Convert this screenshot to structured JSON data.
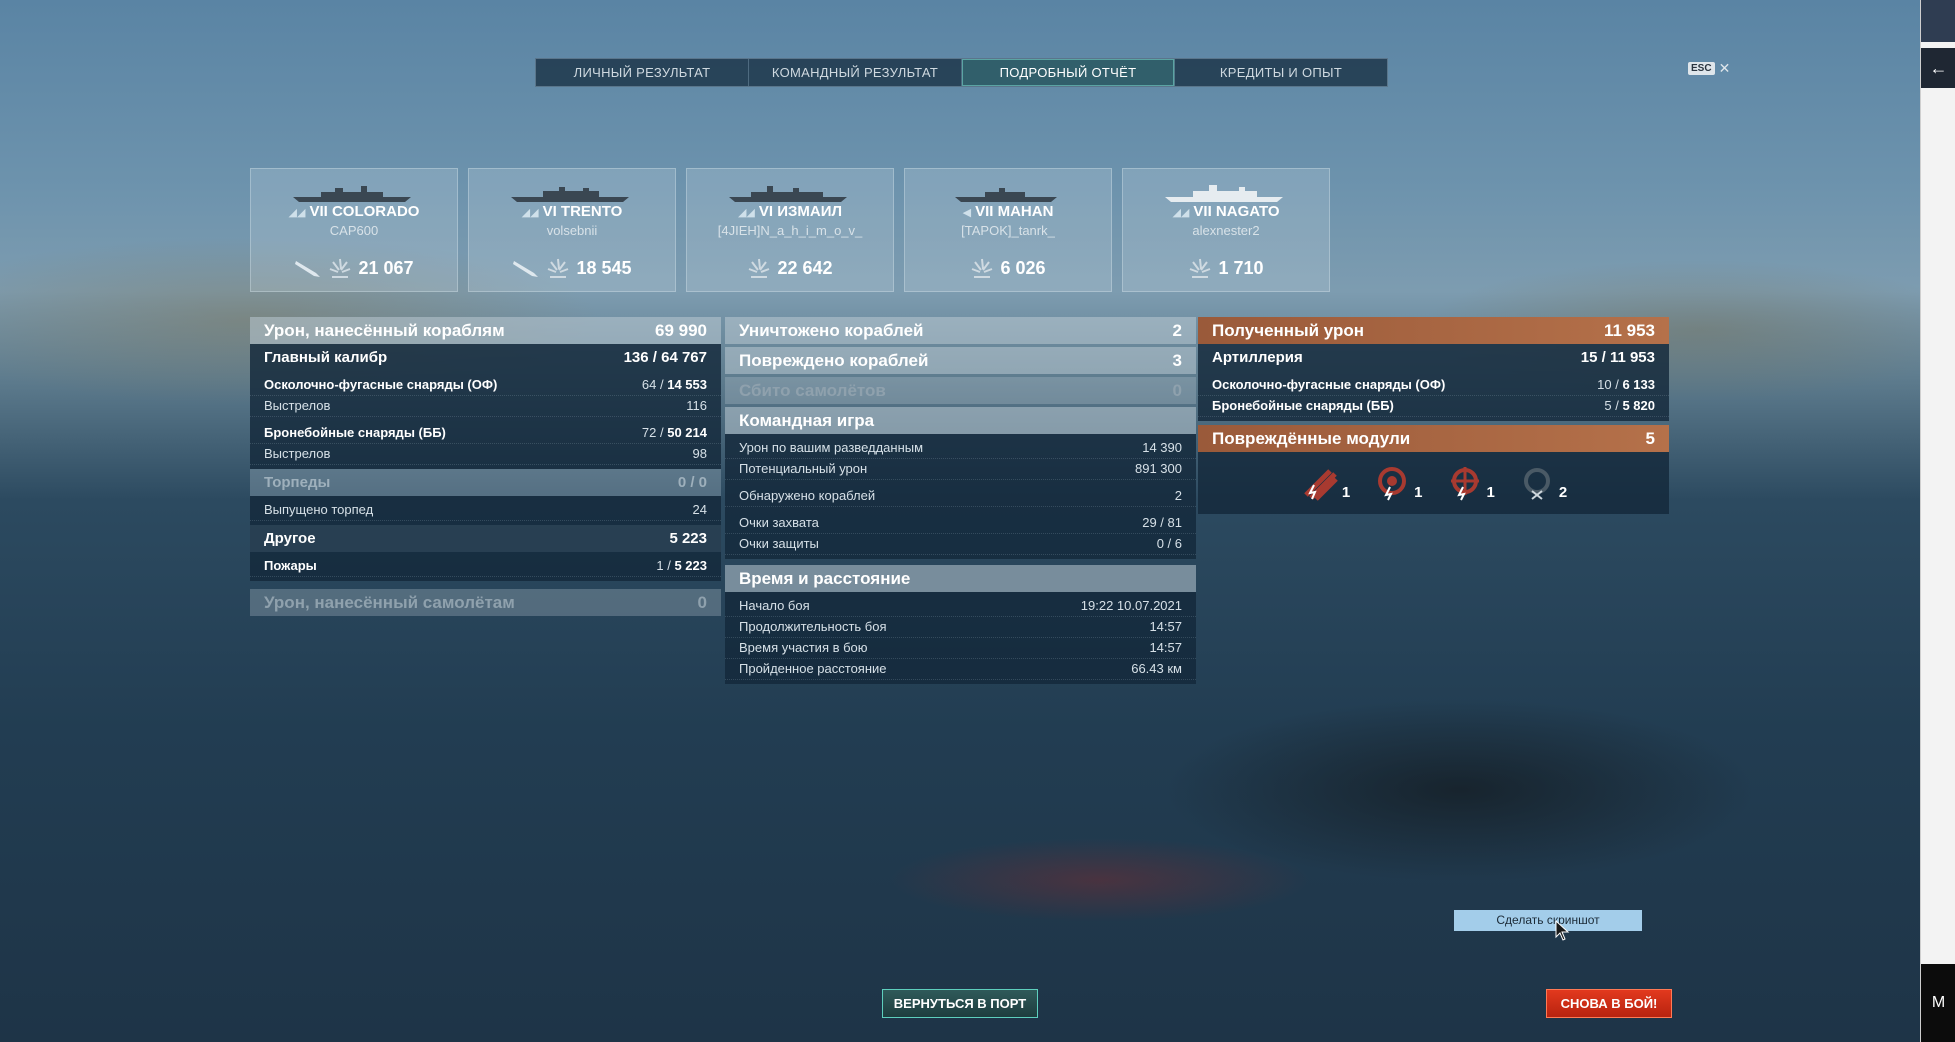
{
  "tabs": [
    {
      "label": "ЛИЧНЫЙ РЕЗУЛЬТАТ",
      "active": false
    },
    {
      "label": "КОМАНДНЫЙ РЕЗУЛЬТАТ",
      "active": false
    },
    {
      "label": "ПОДРОБНЫЙ ОТЧЁТ",
      "active": true
    },
    {
      "label": "КРЕДИТЫ И ОПЫТ",
      "active": false
    }
  ],
  "esc_label": "ESC",
  "ships": [
    {
      "tier_name": "VII COLORADO",
      "player": "CAP600",
      "damage": "21 067",
      "has_torpedo_icon": true
    },
    {
      "tier_name": "VI TRENTO",
      "player": "volsebnii",
      "damage": "18 545",
      "has_torpedo_icon": true
    },
    {
      "tier_name": "VI ИЗМАИЛ",
      "player": "[4JIEH]N_a_h_i_m_o_v_",
      "damage": "22 642",
      "has_torpedo_icon": false
    },
    {
      "tier_name": "VII MAHAN",
      "player": "[TAPOK]_tanrk_",
      "damage": "6 026",
      "has_torpedo_icon": false
    },
    {
      "tier_name": "VII NAGATO",
      "player": "alexnester2",
      "damage": "1 710",
      "has_torpedo_icon": false
    }
  ],
  "left": {
    "header": {
      "label": "Урон, нанесённый кораблям",
      "value": "69 990"
    },
    "main_caliber": {
      "label": "Главный калибр",
      "hits": "136",
      "damage": "64 767"
    },
    "he": {
      "label": "Осколочно-фугасные снаряды (ОФ)",
      "hits": "64",
      "damage": "14 553"
    },
    "he_shots": {
      "label": "Выстрелов",
      "value": "116"
    },
    "ap": {
      "label": "Бронебойные снаряды (ББ)",
      "hits": "72",
      "damage": "50 214"
    },
    "ap_shots": {
      "label": "Выстрелов",
      "value": "98"
    },
    "torpedoes": {
      "label": "Торпеды",
      "value": "0 / 0"
    },
    "torps_launched": {
      "label": "Выпущено торпед",
      "value": "24"
    },
    "other": {
      "label": "Другое",
      "value": "5 223"
    },
    "fires": {
      "label": "Пожары",
      "hits": "1",
      "damage": "5 223"
    },
    "planes_dmg": {
      "label": "Урон, нанесённый самолётам",
      "value": "0"
    }
  },
  "middle": {
    "destroyed": {
      "label": "Уничтожено кораблей",
      "value": "2"
    },
    "damaged": {
      "label": "Повреждено кораблей",
      "value": "3"
    },
    "planes_shot": {
      "label": "Сбито самолётов",
      "value": "0"
    },
    "team_header": "Командная игра",
    "spotting_dmg": {
      "label": "Урон по вашим разведданным",
      "value": "14 390"
    },
    "potential_dmg": {
      "label": "Потенциальный урон",
      "value": "891 300"
    },
    "ships_spotted": {
      "label": "Обнаружено кораблей",
      "value": "2"
    },
    "capture_pts": {
      "label": "Очки захвата",
      "value": "29 / 81"
    },
    "defense_pts": {
      "label": "Очки защиты",
      "value": "0 / 6"
    },
    "time_header": "Время и расстояние",
    "battle_start": {
      "label": "Начало боя",
      "value": "19:22  10.07.2021"
    },
    "battle_duration": {
      "label": "Продолжительность боя",
      "value": "14:57"
    },
    "time_in_battle": {
      "label": "Время участия в бою",
      "value": "14:57"
    },
    "distance": {
      "label": "Пройденное расстояние",
      "value": "66.43 км"
    }
  },
  "right": {
    "received": {
      "label": "Полученный урон",
      "value": "11 953"
    },
    "artillery": {
      "label": "Артиллерия",
      "hits": "15",
      "damage": "11 953"
    },
    "he": {
      "label": "Осколочно-фугасные снаряды (ОФ)",
      "hits": "10",
      "damage": "6 133"
    },
    "ap": {
      "label": "Бронебойные снаряды (ББ)",
      "hits": "5",
      "damage": "5 820"
    },
    "modules_header": {
      "label": "Повреждённые модули",
      "value": "5"
    },
    "modules": [
      {
        "icon": "artillery-module-icon",
        "count": "1"
      },
      {
        "icon": "engine-module-icon",
        "count": "1"
      },
      {
        "icon": "steering-module-icon",
        "count": "1"
      },
      {
        "icon": "destroyed-module-icon",
        "count": "2"
      }
    ]
  },
  "screenshot_button": "Сделать скриншот",
  "buttons": {
    "return_port": "ВЕРНУТЬСЯ В ПОРТ",
    "battle_again": "СНОВА В БОЙ!"
  },
  "colors": {
    "accent_orange": "#b5714a",
    "battle_red": "#e2391e",
    "port_teal": "#5ecfbd"
  }
}
